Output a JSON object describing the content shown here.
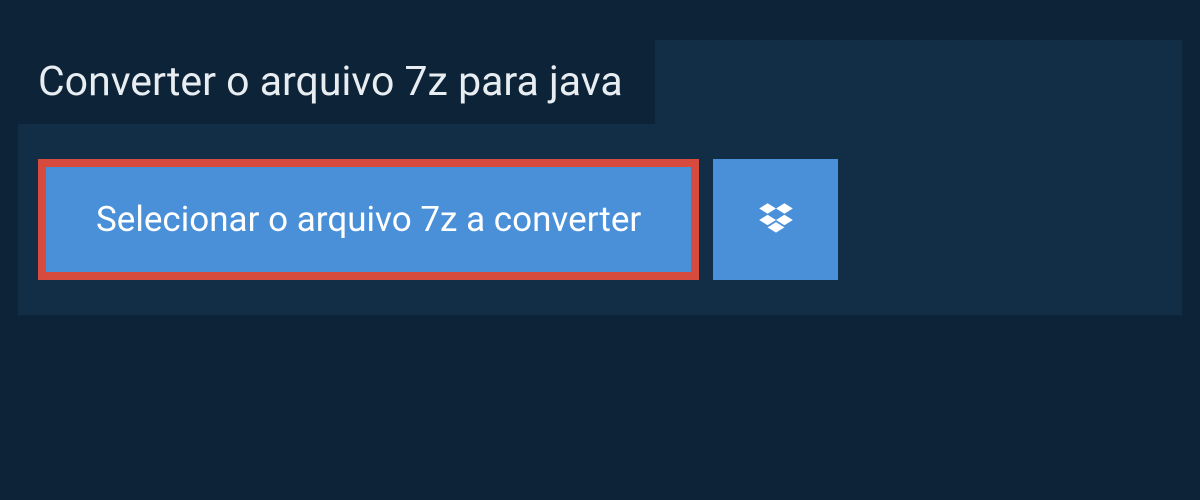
{
  "title": "Converter o arquivo 7z para java",
  "buttons": {
    "select_file": "Selecionar o arquivo 7z a converter"
  },
  "colors": {
    "background_dark": "#0d2438",
    "background_panel": "#122e47",
    "button_primary": "#4a90d9",
    "highlight_border": "#d74b3f",
    "text_light": "#e8edf2"
  }
}
